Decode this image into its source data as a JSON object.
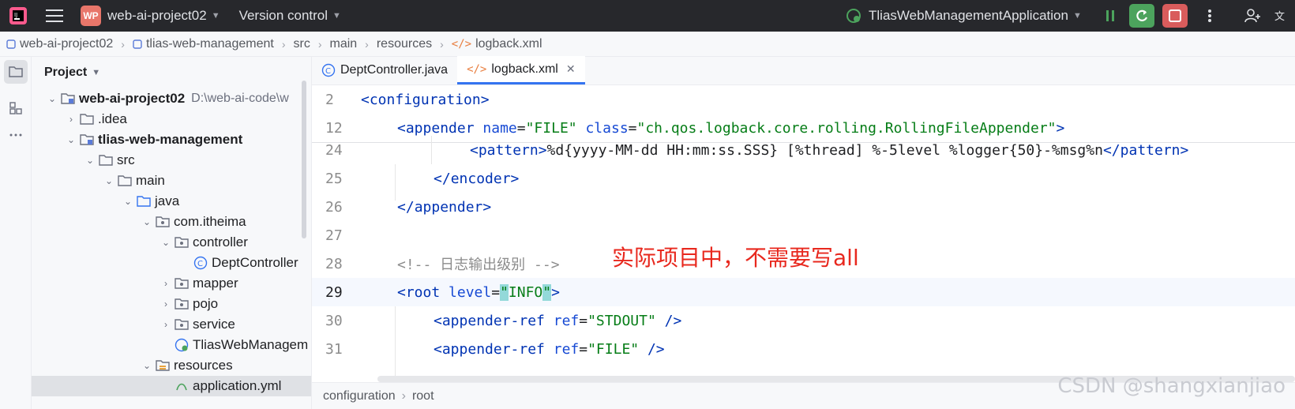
{
  "toolbar": {
    "project_badge": "WP",
    "project_name": "web-ai-project02",
    "vcs": "Version control",
    "run_config": "TliasWebManagementApplication"
  },
  "breadcrumb": [
    "web-ai-project02",
    "tlias-web-management",
    "src",
    "main",
    "resources",
    "logback.xml"
  ],
  "panel": {
    "title": "Project",
    "tree": [
      {
        "label": "web-ai-project02",
        "path": "D:\\web-ai-code\\w"
      },
      {
        "label": ".idea"
      },
      {
        "label": "tlias-web-management"
      },
      {
        "label": "src"
      },
      {
        "label": "main"
      },
      {
        "label": "java"
      },
      {
        "label": "com.itheima"
      },
      {
        "label": "controller"
      },
      {
        "label": "DeptController"
      },
      {
        "label": "mapper"
      },
      {
        "label": "pojo"
      },
      {
        "label": "service"
      },
      {
        "label": "TliasWebManagem"
      },
      {
        "label": "resources"
      },
      {
        "label": "application.yml"
      }
    ]
  },
  "tabs": [
    {
      "label": "DeptController.java"
    },
    {
      "label": "logback.xml"
    }
  ],
  "editor": {
    "lines": [
      {
        "num": "2"
      },
      {
        "num": "12"
      },
      {
        "num": "24"
      },
      {
        "num": "25"
      },
      {
        "num": "26"
      },
      {
        "num": "27"
      },
      {
        "num": "28"
      },
      {
        "num": "29"
      },
      {
        "num": "30"
      },
      {
        "num": "31"
      }
    ],
    "l2": {
      "open": "<",
      "tag": "configuration",
      "close": ">"
    },
    "l12": {
      "tag": "appender",
      "attr1": "name",
      "val1": "\"FILE\"",
      "attr2": "class",
      "val2": "\"ch.qos.logback.core.rolling.RollingFileAppender\""
    },
    "l24": {
      "tag": "pattern",
      "text": "%d{yyyy-MM-dd HH:mm:ss.SSS} [%thread] %-5level %logger{50}-%msg%n",
      "endtag": "pattern"
    },
    "l25": {
      "tag": "encoder"
    },
    "l26": {
      "tag": "appender"
    },
    "l28": {
      "comment": "<!-- 日志输出级别 -->"
    },
    "l29": {
      "tag": "root",
      "attr": "level",
      "q1": "\"",
      "val": "INFO",
      "q2": "\""
    },
    "l30": {
      "tag": "appender-ref",
      "attr": "ref",
      "val": "\"STDOUT\"",
      "end": " />"
    },
    "l31": {
      "tag": "appender-ref",
      "attr": "ref",
      "val": "\"FILE\"",
      "end": " />"
    },
    "annotation": "实际项目中，不需要写all"
  },
  "status": {
    "crumbs": [
      "configuration",
      "root"
    ]
  },
  "watermark": "CSDN @shangxianjiao",
  "colors": {
    "accent": "#3574f0",
    "run_green": "#4ca35d",
    "stop_red": "#d95c5c",
    "annotation": "#e8281e"
  }
}
